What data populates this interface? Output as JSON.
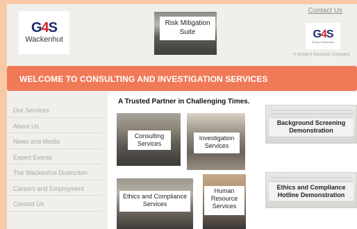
{
  "header": {
    "logo_left": {
      "mark_g": "G",
      "mark_4": "4",
      "mark_s": "S",
      "name": "Wackenhut"
    },
    "logo_right": {
      "mark_g": "G",
      "mark_4": "4",
      "mark_s": "S",
      "name": "Group 4 Securicor"
    },
    "tagline": "A Group 4 Securicor Company",
    "contact_link": "Contact Us",
    "risk_label": "Risk Mitigation Suite"
  },
  "banner": {
    "text": "WELCOME TO CONSULTING AND INVESTIGATION SERVICES"
  },
  "sidebar": {
    "items": [
      {
        "label": "Our Services"
      },
      {
        "label": "About Us"
      },
      {
        "label": "News and Media"
      },
      {
        "label": "Expert Events"
      },
      {
        "label": "The Wackenhut Distinction"
      },
      {
        "label": "Careers and Employment"
      },
      {
        "label": "Contact Us"
      }
    ]
  },
  "main": {
    "title": "A Trusted Partner in Challenging Times.",
    "tiles": {
      "consulting": "Consulting Services",
      "investigation": "Investigation Services",
      "ethics": "Ethics and Compliance Services",
      "hr": "Human Resource Services"
    },
    "demos": {
      "background": "Background Screening Demonstration",
      "hotline": "Ethics and Compliance Hotline Demonstration"
    }
  },
  "colors": {
    "banner": "#f07a57",
    "page_bg": "#f7c9a5",
    "panel_bg": "#f0efeb",
    "nav_text": "#a8a8a4"
  }
}
